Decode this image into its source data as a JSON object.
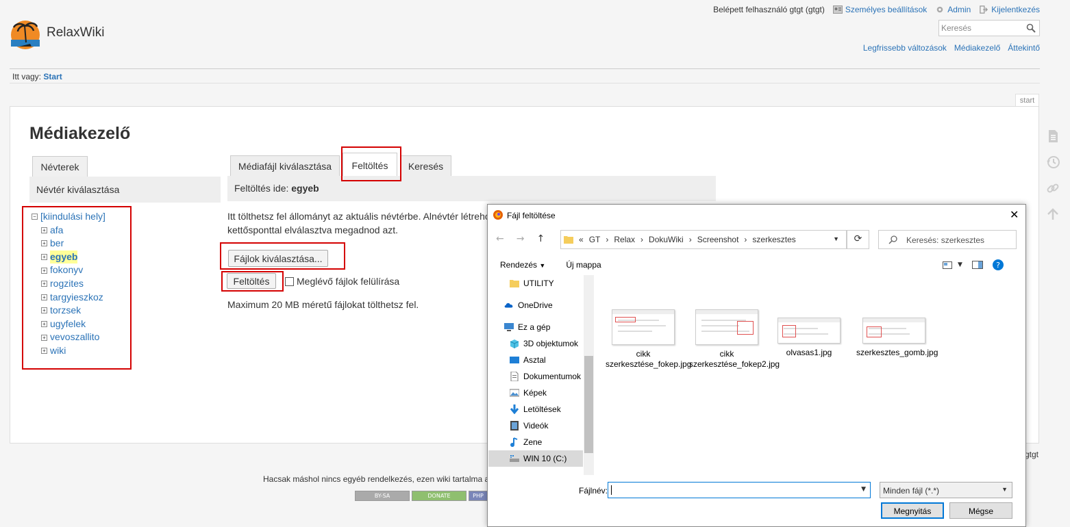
{
  "header": {
    "site_title": "RelaxWiki",
    "logged_in": "Belépett felhasználó gtgt (gtgt)",
    "links": [
      "Személyes beállítások",
      "Admin",
      "Kijelentkezés"
    ],
    "search_placeholder": "Keresés",
    "nav": [
      "Legfrissebb változások",
      "Médiakezelő",
      "Áttekintő"
    ],
    "breadcrumb_prefix": "Itt vagy:",
    "breadcrumb_page": "Start",
    "page_id": "start"
  },
  "media_manager": {
    "title": "Médiakezelő",
    "ns_tab": "Névterek",
    "ns_select": "Névtér kiválasztása",
    "root": "[kiindulási hely]",
    "namespaces": [
      "afa",
      "ber",
      "egyeb",
      "fokonyv",
      "rogzites",
      "targyieszkoz",
      "torzsek",
      "ugyfelek",
      "vevoszallito",
      "wiki"
    ],
    "selected_namespace": "egyeb",
    "tabs": [
      "Médiafájl kiválasztása",
      "Feltöltés",
      "Keresés"
    ],
    "upload_to_label": "Feltöltés ide:",
    "upload_to_ns": "egyeb",
    "upload_help_1": "Itt tölthetsz fel állományt az aktuális névtérbe. Alnévtér létrehozásához",
    "upload_help_2": "kettősponttal elválasztva megadnod azt.",
    "choose_files": "Fájlok kiválasztása...",
    "upload_button": "Feltöltés",
    "overwrite_label": "Meglévő fájlok felülírása",
    "max_size": "Maximum 20 MB méretű fájlokat tölthetsz fel."
  },
  "footer": {
    "user": "gtgt",
    "license": "Hacsak máshol nincs egyéb rendelkezés, ezen wiki tartalma a következő licenc alatt érhető el",
    "badges": [
      "BY-SA",
      "DONATE",
      "PHP"
    ]
  },
  "dialog": {
    "title": "Fájl feltöltése",
    "path": [
      "GT",
      "Relax",
      "DokuWiki",
      "Screenshot",
      "szerkesztes"
    ],
    "path_prefix": "«",
    "search_placeholder": "Keresés: szerkesztes",
    "organize": "Rendezés",
    "new_folder": "Új mappa",
    "nav_items": [
      "UTILITY",
      "OneDrive",
      "Ez a gép",
      "3D objektumok",
      "Asztal",
      "Dokumentumok",
      "Képek",
      "Letöltések",
      "Videók",
      "Zene",
      "WIN 10 (C:)"
    ],
    "files": [
      "cikk szerkesztése_fokep.jpg",
      "cikk szerkesztése_fokep2.jpg",
      "olvasas1.jpg",
      "szerkesztes_gomb.jpg"
    ],
    "filename_label": "Fájlnév:",
    "filename_value": "",
    "filetype": "Minden fájl (*.*)",
    "open_button": "Megnyitás",
    "cancel_button": "Mégse"
  },
  "colors": {
    "link": "#2b73b7",
    "highlight": "#d40000",
    "selection": "#ffff99",
    "dialog_accent": "#0078d7"
  }
}
